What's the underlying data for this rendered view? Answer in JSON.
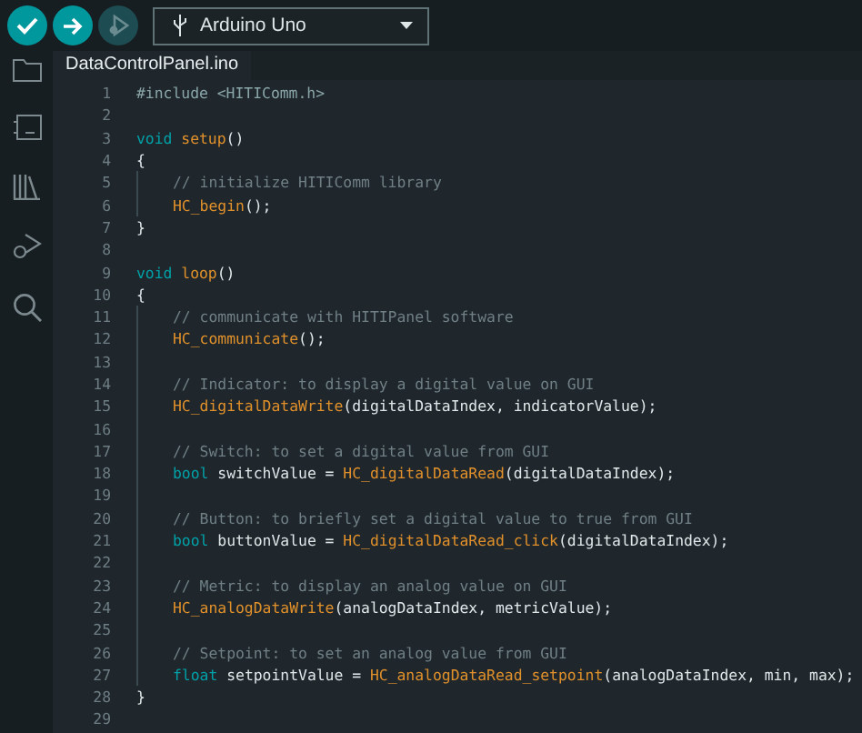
{
  "toolbar": {
    "buttons": [
      {
        "disabled": false
      },
      {
        "disabled": false
      },
      {
        "disabled": true
      }
    ],
    "board": "Arduino Uno"
  },
  "tab": {
    "label": "DataControlPanel.ino"
  },
  "editor": {
    "lines": [
      {
        "number": "1",
        "indented": false,
        "tokens": [
          {
            "kind": "directive",
            "text": "#include <HITIComm.h>"
          }
        ]
      },
      {
        "number": "2",
        "indented": false
      },
      {
        "number": "3",
        "indented": false,
        "tokens": [
          {
            "kind": "keyword",
            "text": "void"
          },
          {
            "kind": "function",
            "text": " setup"
          },
          {
            "kind": "plain",
            "text": "()"
          }
        ]
      },
      {
        "number": "4",
        "indented": false,
        "tokens": [
          {
            "kind": "plain",
            "text": "{"
          }
        ]
      },
      {
        "number": "5",
        "indented": true,
        "tokens": [
          {
            "kind": "comment",
            "text": "// initialize HITIComm library"
          }
        ]
      },
      {
        "number": "6",
        "indented": true,
        "tokens": [
          {
            "kind": "function",
            "text": "HC_begin"
          },
          {
            "kind": "plain",
            "text": "();"
          }
        ]
      },
      {
        "number": "7",
        "indented": false,
        "tokens": [
          {
            "kind": "plain",
            "text": "}"
          }
        ]
      },
      {
        "number": "8",
        "indented": false
      },
      {
        "number": "9",
        "indented": false,
        "tokens": [
          {
            "kind": "keyword",
            "text": "void"
          },
          {
            "kind": "function",
            "text": " loop"
          },
          {
            "kind": "plain",
            "text": "()"
          }
        ]
      },
      {
        "number": "10",
        "indented": false,
        "tokens": [
          {
            "kind": "plain",
            "text": "{"
          }
        ]
      },
      {
        "number": "11",
        "indented": true,
        "tokens": [
          {
            "kind": "comment",
            "text": "// communicate with HITIPanel software"
          }
        ]
      },
      {
        "number": "12",
        "indented": true,
        "tokens": [
          {
            "kind": "function",
            "text": "HC_communicate"
          },
          {
            "kind": "plain",
            "text": "();"
          }
        ]
      },
      {
        "number": "13",
        "indented": true
      },
      {
        "number": "14",
        "indented": true,
        "tokens": [
          {
            "kind": "comment",
            "text": "// Indicator: to display a digital value on GUI"
          }
        ]
      },
      {
        "number": "15",
        "indented": true,
        "tokens": [
          {
            "kind": "function",
            "text": "HC_digitalDataWrite"
          },
          {
            "kind": "plain",
            "text": "(digitalDataIndex, indicatorValue);"
          }
        ]
      },
      {
        "number": "16",
        "indented": true
      },
      {
        "number": "17",
        "indented": true,
        "tokens": [
          {
            "kind": "comment",
            "text": "// Switch: to set a digital value from GUI"
          }
        ]
      },
      {
        "number": "18",
        "indented": true,
        "tokens": [
          {
            "kind": "keyword",
            "text": "bool"
          },
          {
            "kind": "plain",
            "text": " switchValue = "
          },
          {
            "kind": "function",
            "text": "HC_digitalDataRead"
          },
          {
            "kind": "plain",
            "text": "(digitalDataIndex);"
          }
        ]
      },
      {
        "number": "19",
        "indented": true
      },
      {
        "number": "20",
        "indented": true,
        "tokens": [
          {
            "kind": "comment",
            "text": "// Button: to briefly set a digital value to true from GUI"
          }
        ]
      },
      {
        "number": "21",
        "indented": true,
        "tokens": [
          {
            "kind": "keyword",
            "text": "bool"
          },
          {
            "kind": "plain",
            "text": " buttonValue = "
          },
          {
            "kind": "function",
            "text": "HC_digitalDataRead_click"
          },
          {
            "kind": "plain",
            "text": "(digitalDataIndex);"
          }
        ]
      },
      {
        "number": "22",
        "indented": true
      },
      {
        "number": "23",
        "indented": true,
        "tokens": [
          {
            "kind": "comment",
            "text": "// Metric: to display an analog value on GUI"
          }
        ]
      },
      {
        "number": "24",
        "indented": true,
        "tokens": [
          {
            "kind": "function",
            "text": "HC_analogDataWrite"
          },
          {
            "kind": "plain",
            "text": "(analogDataIndex, metricValue);"
          }
        ]
      },
      {
        "number": "25",
        "indented": true
      },
      {
        "number": "26",
        "indented": true,
        "tokens": [
          {
            "kind": "comment",
            "text": "// Setpoint: to set an analog value from GUI"
          }
        ]
      },
      {
        "number": "27",
        "indented": true,
        "tokens": [
          {
            "kind": "keyword",
            "text": "float"
          },
          {
            "kind": "plain",
            "text": " setpointValue = "
          },
          {
            "kind": "function",
            "text": "HC_analogDataRead_setpoint"
          },
          {
            "kind": "plain",
            "text": "(analogDataIndex, min, max);"
          }
        ]
      },
      {
        "number": "28",
        "indented": false,
        "tokens": [
          {
            "kind": "plain",
            "text": "}"
          }
        ]
      },
      {
        "number": "29",
        "indented": false
      }
    ]
  }
}
